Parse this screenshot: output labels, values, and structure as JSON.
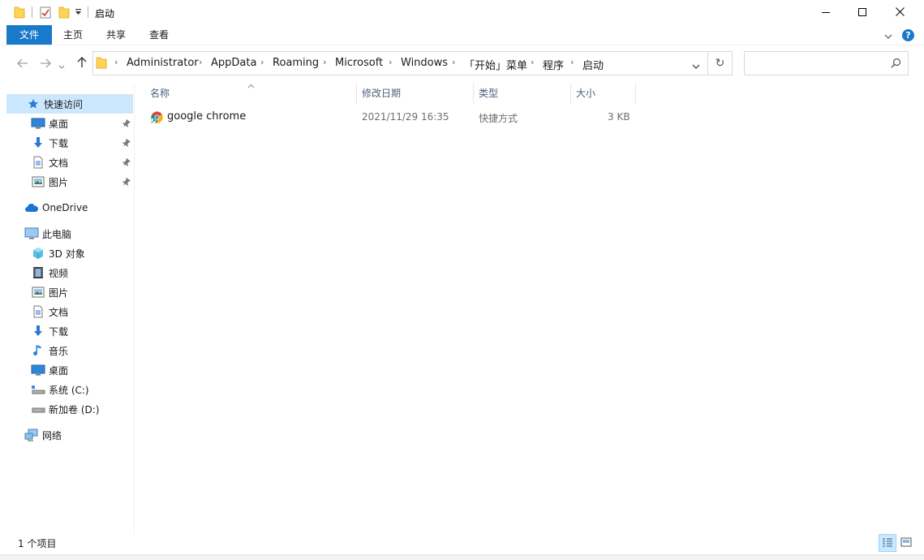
{
  "window": {
    "title": "启动",
    "minimize_icon": "minimize-icon",
    "maximize_icon": "maximize-icon",
    "close_icon": "close-icon"
  },
  "ribbon": {
    "tabs": [
      {
        "label": "文件"
      },
      {
        "label": "主页"
      },
      {
        "label": "共享"
      },
      {
        "label": "查看"
      }
    ],
    "help": "?"
  },
  "address": {
    "crumbs": [
      "Administrator",
      "AppData",
      "Roaming",
      "Microsoft",
      "Windows",
      "「开始」菜单",
      "程序",
      "启动"
    ],
    "refresh_glyph": "↻",
    "search_placeholder": ""
  },
  "nav": {
    "quick_access": "快速访问",
    "pinned": [
      {
        "label": "桌面",
        "icon": "desktop-icon"
      },
      {
        "label": "下载",
        "icon": "download-icon"
      },
      {
        "label": "文档",
        "icon": "document-icon"
      },
      {
        "label": "图片",
        "icon": "picture-icon"
      }
    ],
    "onedrive": "OneDrive",
    "this_pc": "此电脑",
    "pc_items": [
      {
        "label": "3D 对象",
        "icon": "3d-objects-icon"
      },
      {
        "label": "视频",
        "icon": "video-icon"
      },
      {
        "label": "图片",
        "icon": "picture-icon"
      },
      {
        "label": "文档",
        "icon": "document-icon"
      },
      {
        "label": "下载",
        "icon": "download-icon"
      },
      {
        "label": "音乐",
        "icon": "music-icon"
      },
      {
        "label": "桌面",
        "icon": "desktop-icon"
      },
      {
        "label": "系统 (C:)",
        "icon": "system-drive-icon"
      },
      {
        "label": "新加卷 (D:)",
        "icon": "drive-icon"
      }
    ],
    "network": "网络"
  },
  "list": {
    "columns": [
      "名称",
      "修改日期",
      "类型",
      "大小"
    ],
    "sort_indicator": "^",
    "rows": [
      {
        "name": "google chrome",
        "modified": "2021/11/29 16:35",
        "type": "快捷方式",
        "size": "3 KB",
        "icon": "chrome-shortcut-icon"
      }
    ]
  },
  "status": {
    "item_count": "1 个项目"
  },
  "colors": {
    "accent": "#1979ca",
    "selection": "#cce8ff",
    "folder": "#ffd25a"
  }
}
